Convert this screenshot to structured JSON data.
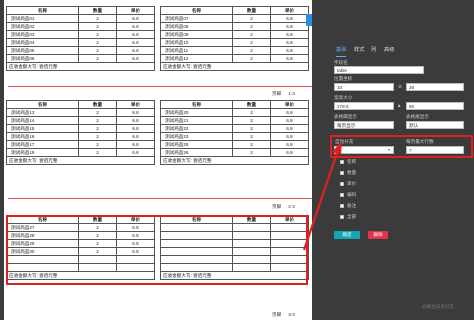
{
  "headers": {
    "name": "名称",
    "qty": "数量",
    "price": "单价"
  },
  "footer_text": "应收金额大写: 壹佰元整",
  "pages": [
    {
      "left": [
        [
          "测试商品01",
          "2",
          "6.8"
        ],
        [
          "测试商品02",
          "2",
          "6.8"
        ],
        [
          "测试商品03",
          "2",
          "6.8"
        ],
        [
          "测试商品04",
          "2",
          "6.8"
        ],
        [
          "测试商品05",
          "2",
          "6.8"
        ],
        [
          "测试商品06",
          "2",
          "6.8"
        ]
      ],
      "right": [
        [
          "测试商品07",
          "2",
          "6.8"
        ],
        [
          "测试商品08",
          "2",
          "6.8"
        ],
        [
          "测试商品09",
          "2",
          "6.8"
        ],
        [
          "测试商品10",
          "2",
          "6.8"
        ],
        [
          "测试商品11",
          "2",
          "6.8"
        ],
        [
          "测试商品12",
          "2",
          "6.8"
        ]
      ],
      "page_label": "页脚",
      "page_num": "1-3"
    },
    {
      "left": [
        [
          "测试商品13",
          "2",
          "6.8"
        ],
        [
          "测试商品14",
          "2",
          "6.8"
        ],
        [
          "测试商品15",
          "2",
          "6.8"
        ],
        [
          "测试商品16",
          "2",
          "6.8"
        ],
        [
          "测试商品17",
          "2",
          "6.8"
        ],
        [
          "测试商品19",
          "2",
          "6.8"
        ]
      ],
      "right": [
        [
          "测试商品20",
          "2",
          "6.8"
        ],
        [
          "测试商品21",
          "2",
          "6.8"
        ],
        [
          "测试商品22",
          "2",
          "6.8"
        ],
        [
          "测试商品23",
          "2",
          "6.8"
        ],
        [
          "测试商品25",
          "2",
          "6.8"
        ],
        [
          "测试商品26",
          "2",
          "6.8"
        ]
      ],
      "page_label": "页脚",
      "page_num": "2-3"
    },
    {
      "left": [
        [
          "测试商品27",
          "2",
          "6.8"
        ],
        [
          "测试商品28",
          "2",
          "6.8"
        ],
        [
          "测试商品29",
          "2",
          "6.8"
        ],
        [
          "测试商品30",
          "2",
          "6.8"
        ],
        [
          "",
          "",
          ""
        ],
        [
          "",
          "",
          ""
        ]
      ],
      "right": [
        [
          "",
          "",
          ""
        ],
        [
          "",
          "",
          ""
        ],
        [
          "",
          "",
          ""
        ],
        [
          "",
          "",
          ""
        ],
        [
          "",
          "",
          ""
        ],
        [
          "",
          "",
          ""
        ]
      ],
      "page_label": "页脚",
      "page_num": "3-3"
    }
  ],
  "top_button": "print",
  "panel": {
    "tabs": [
      "基础",
      "样式",
      "列",
      "高级"
    ],
    "field_name_label": "字段名",
    "field_name_value": "table",
    "pos_label": "位置坐标",
    "pos_x": "10",
    "pos_y": "28",
    "size_label": "宽高大小",
    "size_w": "278.5",
    "size_h": "60",
    "footer_show_label": "表格脚显示",
    "footer_show_value": "每页显示",
    "fixed_rows_label": "表格尾显示",
    "fixed_rows_value": "默认",
    "auto_fill_label": "自动补充",
    "auto_fill_value": "是",
    "max_rows_label": "每页最大行数",
    "max_rows_value": "7",
    "checkboxes": [
      "名称",
      "数量",
      "单价",
      "编码",
      "备注",
      "全部"
    ],
    "confirm_button": "确定",
    "delete_button": "删除"
  },
  "watermark": "@掘金技术社区",
  "colors": {
    "highlight": "#e02020",
    "accent": "#2f8be6",
    "confirm": "#13a6b5",
    "delete": "#e2344f"
  }
}
